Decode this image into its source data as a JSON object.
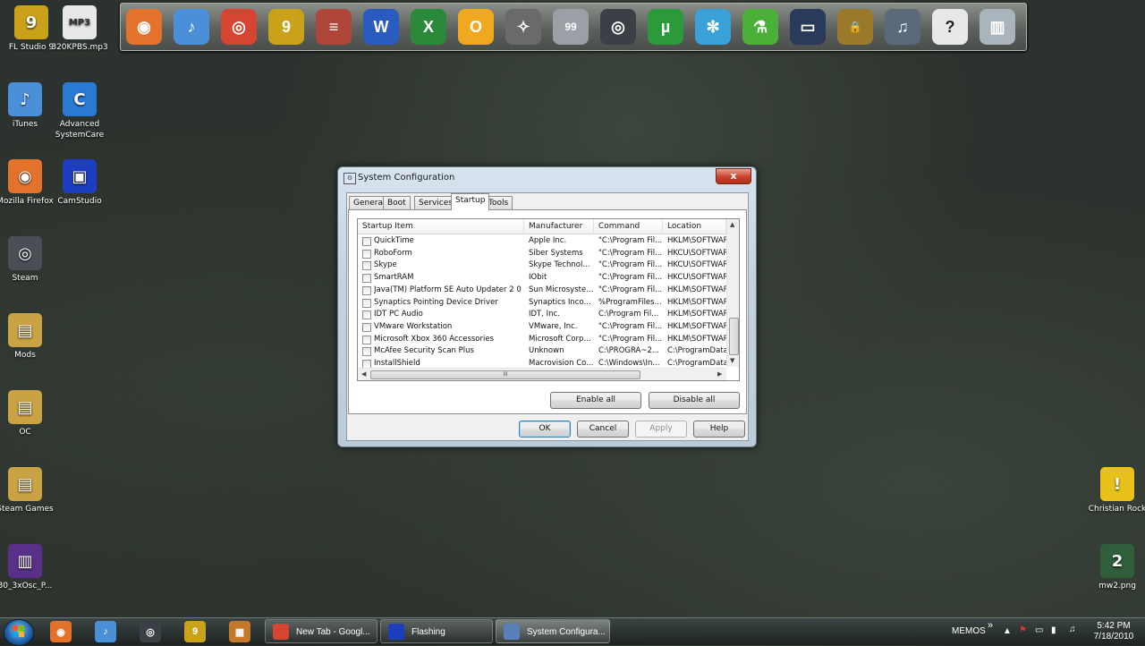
{
  "desktop": {
    "icons": [
      {
        "label": "FL Studio 9",
        "glyph": "9",
        "color": "#c9a21a",
        "icon": "fl-studio-icon"
      },
      {
        "label": "320KPBS.mp3",
        "glyph": "MP3",
        "color": "#e8e8e8",
        "icon": "mp3-file-icon"
      },
      {
        "label": "iTunes",
        "glyph": "♪",
        "color": "#4a8fd8",
        "icon": "itunes-icon"
      },
      {
        "label": "Advanced SystemCare",
        "glyph": "C",
        "color": "#2a7ad4",
        "icon": "advanced-systemcare-icon"
      },
      {
        "label": "Mozilla Firefox",
        "glyph": "◉",
        "color": "#e3722a",
        "icon": "firefox-icon"
      },
      {
        "label": "CamStudio",
        "glyph": "▣",
        "color": "#1d3fbf",
        "icon": "camstudio-icon"
      },
      {
        "label": "Steam",
        "glyph": "◎",
        "color": "#4a4f55",
        "icon": "steam-icon"
      },
      {
        "label": "Mods",
        "glyph": "▤",
        "color": "#c9a244",
        "icon": "folder-icon"
      },
      {
        "label": "OC",
        "glyph": "▤",
        "color": "#c9a244",
        "icon": "folder-icon"
      },
      {
        "label": "Steam Games",
        "glyph": "▤",
        "color": "#c9a244",
        "icon": "folder-icon"
      },
      {
        "label": "30_3xOsc_P...",
        "glyph": "▥",
        "color": "#5a2f8a",
        "icon": "winrar-archive-icon"
      },
      {
        "label": "Christian Rock",
        "glyph": "!",
        "color": "#e8c21a",
        "icon": "shield-shortcut-icon"
      },
      {
        "label": "mw2.png",
        "glyph": "2",
        "color": "#2e5e3a",
        "icon": "image-file-icon"
      }
    ]
  },
  "dock": {
    "items": [
      {
        "icon": "firefox-icon",
        "glyph": "◉",
        "color": "#e3722a"
      },
      {
        "icon": "itunes-icon",
        "glyph": "♪",
        "color": "#4a8fd8"
      },
      {
        "icon": "chrome-icon",
        "glyph": "◎",
        "color": "#d64532"
      },
      {
        "icon": "fl-studio-icon",
        "glyph": "9",
        "color": "#c9a21a"
      },
      {
        "icon": "archive-books-icon",
        "glyph": "≡",
        "color": "#b0453a"
      },
      {
        "icon": "word-icon",
        "glyph": "W",
        "color": "#2a5bbf"
      },
      {
        "icon": "excel-icon",
        "glyph": "X",
        "color": "#2a8a3a"
      },
      {
        "icon": "outlook-icon",
        "glyph": "O",
        "color": "#f0a820"
      },
      {
        "icon": "compass-icon",
        "glyph": "✧",
        "color": "#6a6a6a"
      },
      {
        "icon": "monitor-99-icon",
        "glyph": "99",
        "color": "#9aa0a6"
      },
      {
        "icon": "steam-icon",
        "glyph": "◎",
        "color": "#3b4047"
      },
      {
        "icon": "utorrent-icon",
        "glyph": "µ",
        "color": "#2a9a3a"
      },
      {
        "icon": "snowflake-icon",
        "glyph": "✻",
        "color": "#3aa0d8"
      },
      {
        "icon": "flask-icon",
        "glyph": "⚗",
        "color": "#4ab03a"
      },
      {
        "icon": "monitor-icon",
        "glyph": "▭",
        "color": "#2a3a5a"
      },
      {
        "icon": "padlock-icon",
        "glyph": "🔒",
        "color": "#9a7a2a"
      },
      {
        "icon": "music-note-icon",
        "glyph": "♫",
        "color": "#5a6a7a"
      },
      {
        "icon": "help-icon",
        "glyph": "?",
        "color": "#e8e8e8"
      },
      {
        "icon": "recycle-bin-icon",
        "glyph": "▥",
        "color": "#aab4bc"
      }
    ]
  },
  "window": {
    "title": "System Configuration",
    "close_label": "x",
    "tabs": [
      {
        "label": "General"
      },
      {
        "label": "Boot"
      },
      {
        "label": "Services"
      },
      {
        "label": "Startup",
        "active": true
      },
      {
        "label": "Tools"
      }
    ],
    "columns": [
      "Startup Item",
      "Manufacturer",
      "Command",
      "Location"
    ],
    "rows": [
      {
        "item": "QuickTime",
        "manufacturer": "Apple Inc.",
        "command": "\"C:\\Program Fil...",
        "location": "HKLM\\SOFTWAR..."
      },
      {
        "item": "RoboForm",
        "manufacturer": "Siber Systems",
        "command": "\"C:\\Program Fil...",
        "location": "HKCU\\SOFTWAR..."
      },
      {
        "item": "Skype",
        "manufacturer": "Skype Technol...",
        "command": "\"C:\\Program Fil...",
        "location": "HKCU\\SOFTWAR..."
      },
      {
        "item": "SmartRAM",
        "manufacturer": "IObit",
        "command": "\"C:\\Program Fil...",
        "location": "HKCU\\SOFTWAR..."
      },
      {
        "item": "Java(TM) Platform SE Auto Updater 2 0",
        "manufacturer": "Sun Microsyste...",
        "command": "\"C:\\Program Fil...",
        "location": "HKLM\\SOFTWAR..."
      },
      {
        "item": "Synaptics Pointing Device Driver",
        "manufacturer": "Synaptics Inco...",
        "command": "%ProgramFiles...",
        "location": "HKLM\\SOFTWAR..."
      },
      {
        "item": "IDT PC Audio",
        "manufacturer": "IDT, Inc.",
        "command": "C:\\Program Fil...",
        "location": "HKLM\\SOFTWAR..."
      },
      {
        "item": "VMware Workstation",
        "manufacturer": "VMware, Inc.",
        "command": "\"C:\\Program Fil...",
        "location": "HKLM\\SOFTWAR..."
      },
      {
        "item": "Microsoft Xbox 360 Accessories",
        "manufacturer": "Microsoft Corp...",
        "command": "\"C:\\Program Fil...",
        "location": "HKLM\\SOFTWAR..."
      },
      {
        "item": "McAfee Security Scan Plus",
        "manufacturer": "Unknown",
        "command": "C:\\PROGRA~2...",
        "location": "C:\\ProgramData\\..."
      },
      {
        "item": "InstallShield",
        "manufacturer": "Macrovision Co...",
        "command": "C:\\Windows\\In...",
        "location": "C:\\ProgramData\\..."
      }
    ],
    "hscroll_grip": "III",
    "enable_all": "Enable all",
    "disable_all": "Disable all",
    "ok": "OK",
    "cancel": "Cancel",
    "apply": "Apply",
    "help": "Help"
  },
  "taskbar": {
    "pinned": [
      {
        "icon": "firefox-icon",
        "glyph": "◉",
        "color": "#e3722a"
      },
      {
        "icon": "itunes-icon",
        "glyph": "♪",
        "color": "#4a8fd8"
      },
      {
        "icon": "steam-icon",
        "glyph": "◎",
        "color": "#3b4047"
      },
      {
        "icon": "fl-studio-icon",
        "glyph": "9",
        "color": "#c9a21a"
      },
      {
        "icon": "puzzle-app-icon",
        "glyph": "▦",
        "color": "#c4782a"
      }
    ],
    "tasks": [
      {
        "label": "New Tab - Googl...",
        "icon": "chrome-icon",
        "color": "#d64532",
        "active": false
      },
      {
        "label": "Flashing",
        "icon": "camstudio-icon",
        "color": "#1d3fbf",
        "active": false
      },
      {
        "label": "System Configura...",
        "icon": "system-configuration-icon",
        "color": "#5a7fb8",
        "active": true
      }
    ],
    "memos": "MEMOS",
    "chevron": "»",
    "time": "5:42 PM",
    "date": "7/18/2010"
  }
}
